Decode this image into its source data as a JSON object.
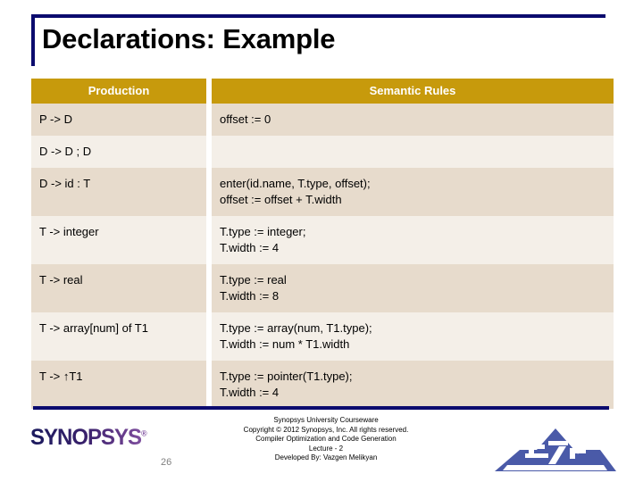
{
  "slide": {
    "title": "Declarations: Example",
    "page_number": "26",
    "accent_navy": "#0b0b6e",
    "header_gold": "#c79a0c",
    "row_shade_dark": "#e7dbcc",
    "row_shade_light": "#f4efe8"
  },
  "table": {
    "columns": [
      "Production",
      "Semantic Rules"
    ],
    "rows": [
      {
        "production": "P -> D",
        "rules": [
          "offset := 0"
        ]
      },
      {
        "production": "D -> D ; D",
        "rules": []
      },
      {
        "production": "D -> id : T",
        "rules": [
          "enter(id.name, T.type, offset);",
          "offset := offset + T.width"
        ]
      },
      {
        "production": "T -> integer",
        "rules": [
          "T.type := integer;",
          "T.width := 4"
        ]
      },
      {
        "production": "T -> real",
        "rules": [
          "T.type := real",
          "T.width := 8"
        ]
      },
      {
        "production": "T -> array[num] of T1",
        "rules": [
          "T.type := array(num, T1.type);",
          "T.width := num * T1.width"
        ]
      },
      {
        "production": "T -> ↑T1",
        "rules": [
          "T.type := pointer(T1.type);",
          "T.width := 4"
        ]
      }
    ]
  },
  "footer": {
    "logo_text": "SYNOPSYS",
    "logo_tm": "®",
    "lines": [
      "Synopsys University Courseware",
      "Copyright © 2012 Synopsys, Inc. All rights reserved.",
      "Compiler Optimization and Code Generation",
      "Lecture - 2",
      "Developed By: Vazgen Melikyan"
    ],
    "secondary_logo": "seua-mountain-logo"
  }
}
